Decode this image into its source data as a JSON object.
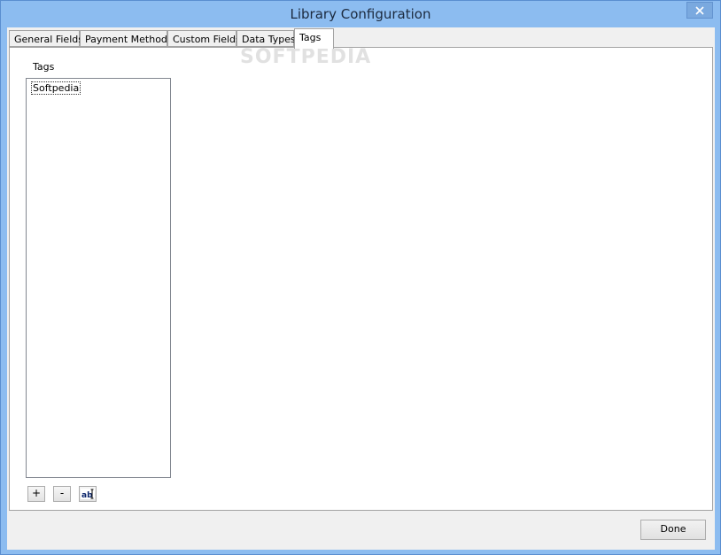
{
  "window": {
    "title": "Library Configuration"
  },
  "tabs": [
    {
      "label": "General Fields"
    },
    {
      "label": "Payment Methods"
    },
    {
      "label": "Custom Fields"
    },
    {
      "label": "Data Types"
    },
    {
      "label": "Tags"
    }
  ],
  "active_tab": "Tags",
  "tags_panel": {
    "label": "Tags",
    "items": [
      "Softpedia"
    ],
    "add_label": "+",
    "remove_label": "-",
    "rename_icon": "rename-icon"
  },
  "footer": {
    "done_label": "Done"
  },
  "watermark": "SOFTPEDIA",
  "colors": {
    "titlebar": "#8cbcf0",
    "client": "#f0f0f0",
    "panel": "#ffffff"
  }
}
